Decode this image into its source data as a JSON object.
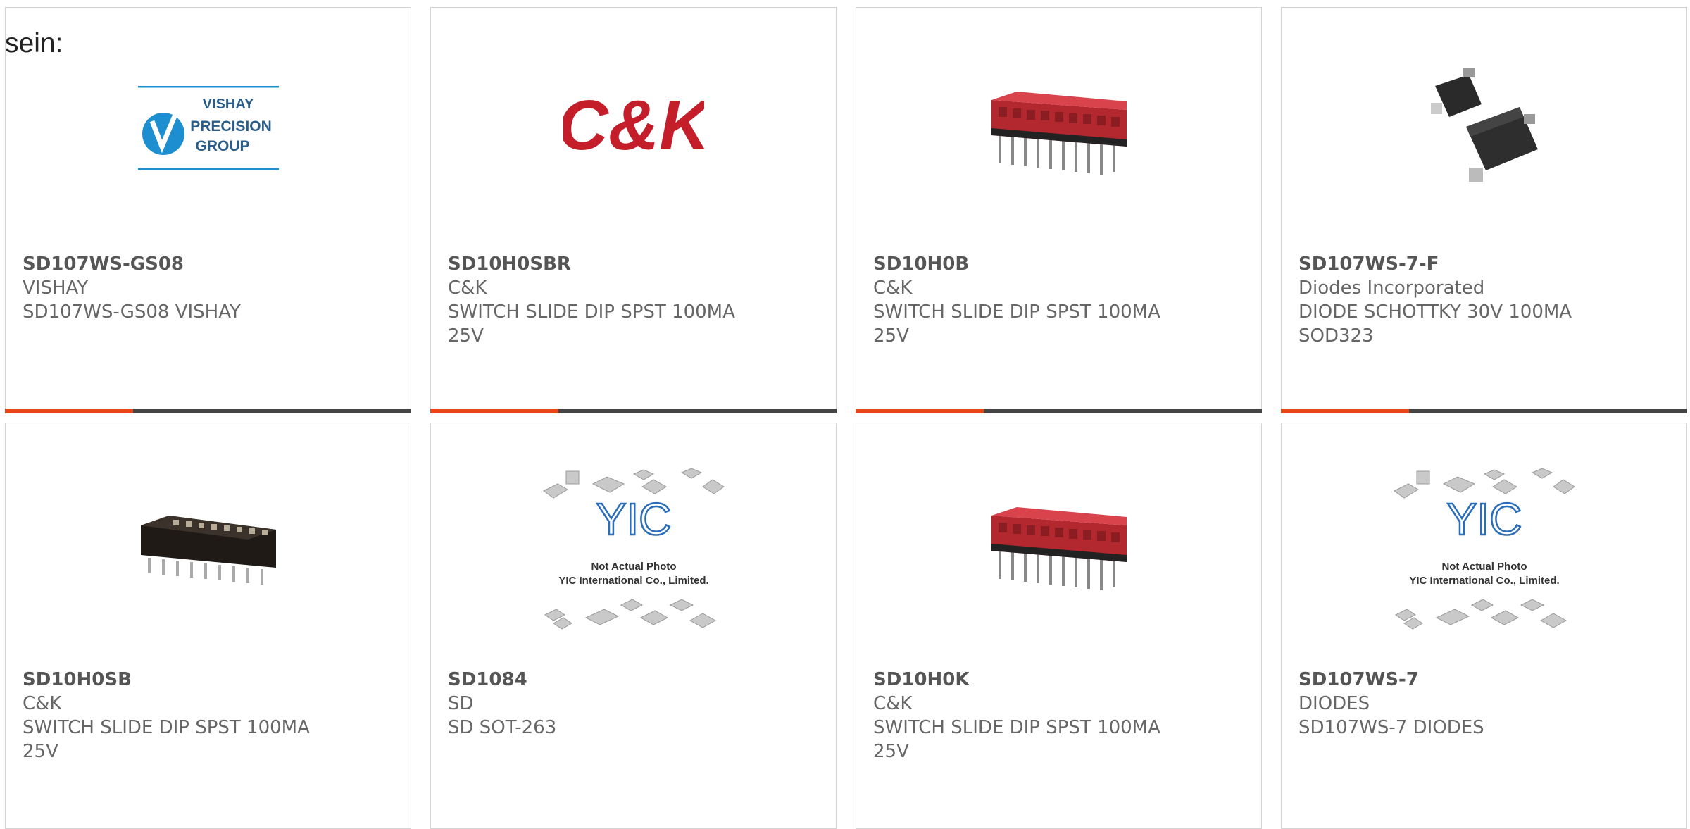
{
  "page": {
    "caption": "sein:"
  },
  "colors": {
    "accent": "#e8451b",
    "bar": "#454545",
    "border": "#d4d4d4"
  },
  "products": [
    {
      "part_number": "SD107WS-GS08",
      "manufacturer": "VISHAY",
      "description": "SD107WS-GS08 VISHAY",
      "image": "vishay-precision-group-logo",
      "logo_text": [
        "VISHAY",
        "PRECISION",
        "GROUP"
      ]
    },
    {
      "part_number": "SD10H0SBR",
      "manufacturer": "C&K",
      "description": "SWITCH SLIDE DIP SPST 100MA 25V",
      "image": "ck-logo",
      "logo_text": [
        "C&K"
      ]
    },
    {
      "part_number": "SD10H0B",
      "manufacturer": "C&K",
      "description": "SWITCH SLIDE DIP SPST 100MA 25V",
      "image": "red-dip-switch-photo"
    },
    {
      "part_number": "SD107WS-7-F",
      "manufacturer": "Diodes Incorporated",
      "description": "DIODE SCHOTTKY 30V 100MA SOD323",
      "image": "sod323-diode-photo"
    },
    {
      "part_number": "SD10H0SB",
      "manufacturer": "C&K",
      "description": "SWITCH SLIDE DIP SPST 100MA 25V",
      "image": "black-dip-switch-photo"
    },
    {
      "part_number": "SD1084",
      "manufacturer": "SD",
      "description": "SD SOT-263",
      "image": "yic-placeholder",
      "placeholder_text": [
        "Not Actual Photo",
        "YIC International Co., Limited."
      ]
    },
    {
      "part_number": "SD10H0K",
      "manufacturer": "C&K",
      "description": "SWITCH SLIDE DIP SPST 100MA 25V",
      "image": "red-dip-switch-photo"
    },
    {
      "part_number": "SD107WS-7",
      "manufacturer": "DIODES",
      "description": "SD107WS-7 DIODES",
      "image": "yic-placeholder",
      "placeholder_text": [
        "Not Actual Photo",
        "YIC International Co., Limited."
      ]
    }
  ]
}
